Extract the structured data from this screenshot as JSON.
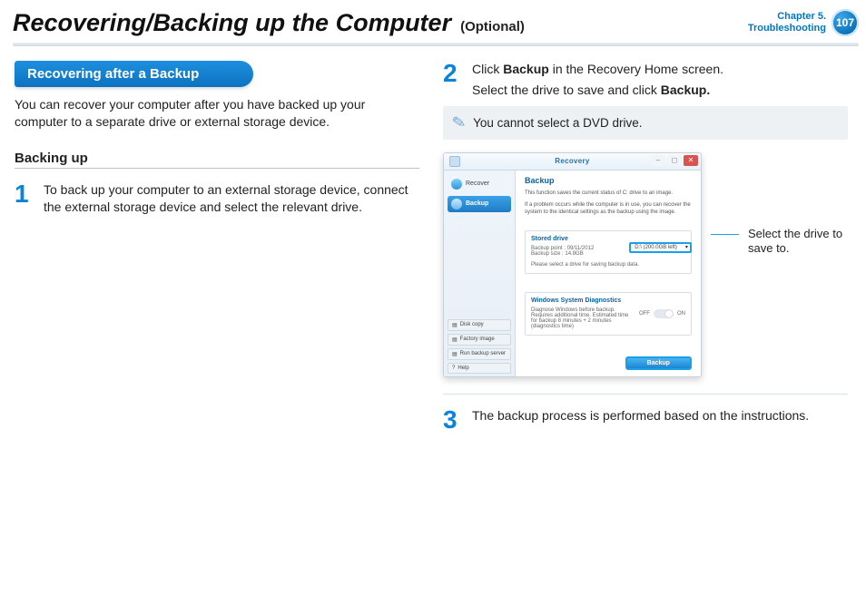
{
  "header": {
    "title": "Recovering/Backing up the Computer",
    "subtitle": "(Optional)",
    "chapter_line1": "Chapter 5.",
    "chapter_line2": "Troubleshooting",
    "page": "107"
  },
  "left": {
    "section_label": "Recovering after a Backup",
    "intro": "You can recover your computer after you have backed up your computer to a separate drive or external storage device.",
    "subhead": "Backing up",
    "step1_num": "1",
    "step1_text": "To back up your computer to an external storage device, connect the external storage device and select the relevant drive."
  },
  "right": {
    "step2_num": "2",
    "step2_a": "Click ",
    "step2_b": "Backup",
    "step2_c": " in the Recovery Home screen.",
    "step2_d": "Select the drive to save and click ",
    "step2_e": "Backup.",
    "note": "You cannot select a DVD drive.",
    "callout": "Select the drive to save to.",
    "step3_num": "3",
    "step3_text": "The backup process is performed based on the instructions."
  },
  "shot": {
    "window_title": "Recovery",
    "nav": {
      "recover": "Recover",
      "backup": "Backup",
      "disk_copy": "Disk copy",
      "factory_image": "Factory image",
      "run_backup": "Run backup server",
      "help": "Help"
    },
    "main": {
      "heading": "Backup",
      "desc1": "This function saves the current status of C: drive to an image.",
      "desc2": "If a problem occurs while the computer is in use, you can recover the system to the identical settings as the backup using the image.",
      "stored_title": "Stored drive",
      "bp": "Backup point : 09/11/2012",
      "bs": "Backup size : 14.8GB",
      "sel": "Please select a drive for saving backup data.",
      "combo": "D:\\ (200.0GB left)",
      "diag_title": "Windows System Diagnostics",
      "diag_text": "Diagnose Windows before backup. Requires additional time. Estimated time for backup 8 minutes + 2 minutes (diagnostics time)",
      "off": "OFF",
      "on": "ON",
      "primary": "Backup"
    }
  }
}
